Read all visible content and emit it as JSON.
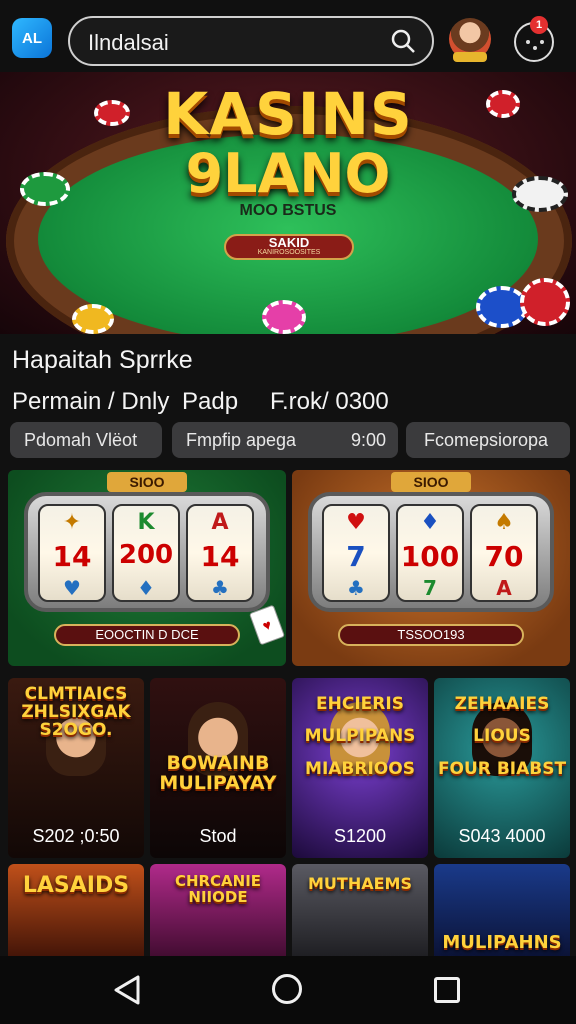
{
  "topbar": {
    "app_logo": "AL",
    "search_value": "Ilndalsai",
    "notification_count": "1"
  },
  "hero": {
    "title_line1": "KASINS",
    "title_line2": "9LANO",
    "subtitle": "MOO BSTUS",
    "pill_label": "SAKID",
    "pill_small": "KANIROSOOSITES"
  },
  "section": {
    "title": "Hapaitah Sprrke",
    "row_left": "Permain / Dnly",
    "row_mid": "Padp",
    "row_right": "F.rok/ 0300"
  },
  "filters": [
    {
      "label": "Pdomah Vlëot"
    },
    {
      "label": "Fmpfip apega",
      "time": "9:00"
    },
    {
      "label": "Fcomepsioropa"
    }
  ],
  "slots": [
    {
      "top": "SIOO",
      "reels": [
        [
          "✦",
          "14",
          "♥"
        ],
        [
          "K",
          "200",
          "♦"
        ],
        [
          "A",
          "14",
          "♣"
        ]
      ],
      "bar": "EOOCTIN D DCE"
    },
    {
      "top": "SIOO",
      "reels": [
        [
          "♥",
          "7",
          "♣"
        ],
        [
          "♦",
          "100",
          "7"
        ],
        [
          "♠",
          "70",
          "A"
        ]
      ],
      "bar": "TSSOO193"
    }
  ],
  "games_row2": [
    {
      "logo": "CLMTIAICS\nZHLSIXGAK\nS2OGO.",
      "price": "S202 ;0:50"
    },
    {
      "logo": "BOWAINB\nMULIPAYAY",
      "price": "Stod"
    },
    {
      "logo": "EHCIERIS\nMULPIPANS\nMIABRIOOS",
      "price": "S1200"
    },
    {
      "logo": "ZEHAAIES\nLIOUS\nFOUR BIABST",
      "price": "S043 4000"
    }
  ],
  "games_row3": [
    {
      "logo": "LASAIDS"
    },
    {
      "logo": "CHRCANIE\nNIIODE"
    },
    {
      "logo": "MUTHAEMS"
    },
    {
      "logo": "MULIPAHNS"
    }
  ],
  "colors": {
    "accent_gold": "#ffd23c",
    "felt_green": "#138a3a",
    "chip_bg": "#3b3b3d"
  }
}
